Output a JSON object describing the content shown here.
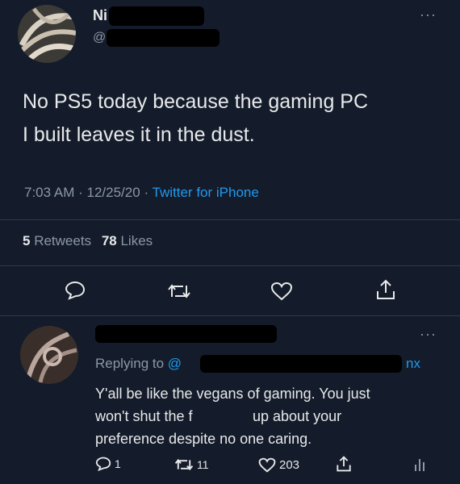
{
  "tweet": {
    "author_name": "Ni",
    "author_handle": "@",
    "text_line1": "No PS5 today because the gaming PC",
    "text_line2": "I built leaves it in the dust.",
    "time": "7:03 AM",
    "sep1": "·",
    "date": "12/25/20",
    "sep2": "·",
    "source": "Twitter for iPhone",
    "retweets_count": "5",
    "retweets_label": "Retweets",
    "likes_count": "78",
    "likes_label": "Likes",
    "more": "···"
  },
  "reply": {
    "replying_to": "Replying to",
    "replying_handle_start": "@",
    "replying_handle_end": "nx",
    "line1": "Y'all be like the vegans of gaming. You just",
    "line2a": "won't shut the f",
    "line2b": "up about your",
    "line3": "preference despite no one caring.",
    "reply_count": "1",
    "retweet_count": "11",
    "like_count": "203",
    "more": "···"
  },
  "colors": {
    "background": "#141b2a",
    "text": "#e7e9ea",
    "muted": "#8b98a5",
    "link": "#1d9bf0"
  },
  "icons": [
    "reply-icon",
    "retweet-icon",
    "like-icon",
    "share-icon",
    "analytics-icon"
  ]
}
